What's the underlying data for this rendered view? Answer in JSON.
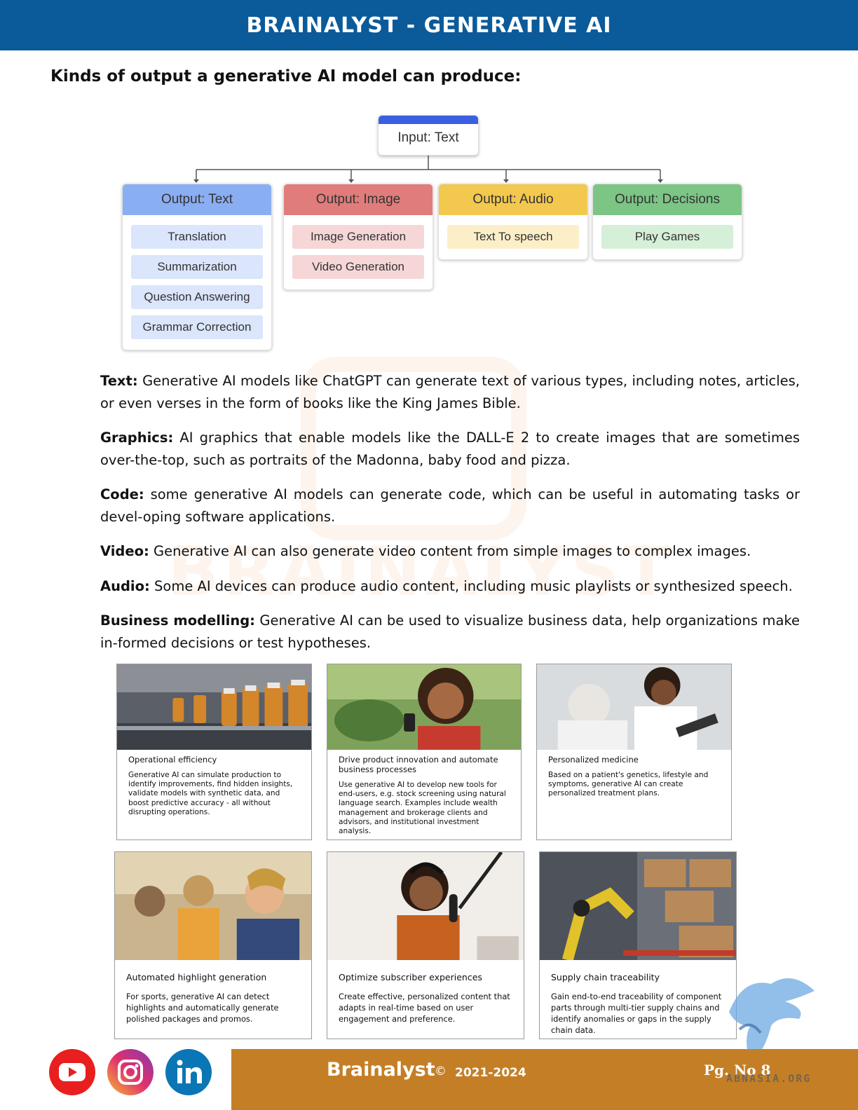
{
  "header": {
    "title": "BRAINALYST - GENERATIVE AI"
  },
  "section_heading": "Kinds of output a generative AI model can produce:",
  "watermark": {
    "text": "BRAINALYST"
  },
  "diagram": {
    "input": "Input: Text",
    "columns": [
      {
        "head": "Output: Text",
        "color": "#8aaef2",
        "items": [
          "Translation",
          "Summarization",
          "Question Answering",
          "Grammar Correction"
        ]
      },
      {
        "head": "Output: Image",
        "color": "#e17c7c",
        "items": [
          "Image Generation",
          "Video Generation"
        ]
      },
      {
        "head": "Output: Audio",
        "color": "#f3c84f",
        "items": [
          "Text To speech"
        ]
      },
      {
        "head": "Output: Decisions",
        "color": "#7cc585",
        "items": [
          "Play Games"
        ]
      }
    ]
  },
  "paragraphs": [
    {
      "label": "Text:",
      "text": " Generative AI models like ChatGPT can generate text of various types, including notes, articles, or even verses in the form of books like the King James Bible."
    },
    {
      "label": "Graphics:",
      "text": " AI graphics that enable models like the DALL-E 2 to create images that are sometimes over-the-top, such as portraits of the Madonna, baby food and pizza."
    },
    {
      "label": "Code:",
      "text": " some generative AI models can generate code, which can be useful in automating tasks or devel-oping software applications."
    },
    {
      "label": "Video:",
      "text": " Generative AI can also generate video content from simple images to complex images."
    },
    {
      "label": "Audio:",
      "text": " Some AI devices can produce audio content, including music playlists or synthesized speech."
    },
    {
      "label": "Business modelling:",
      "text": " Generative AI can be used to visualize business data, help organizations make in-formed decisions or test hypotheses."
    }
  ],
  "cards": [
    {
      "title": "Operational efficiency",
      "body": "Generative AI can simulate production to identify improvements, find hidden insights, validate models with synthetic data, and boost predictive accuracy - all without disrupting operations."
    },
    {
      "title": "Drive product innovation and automate business processes",
      "body": "Use generative AI to develop new tools for end-users, e.g. stock screening using natural language search. Examples include wealth management and brokerage clients and advisors, and institutional investment analysis."
    },
    {
      "title": "Personalized medicine",
      "body": "Based on a patient's genetics, lifestyle and symptoms, generative AI can create personalized treatment plans."
    },
    {
      "title": "Automated highlight generation",
      "body": "For sports, generative AI can detect highlights and automatically generate polished packages and promos."
    },
    {
      "title": "Optimize subscriber experiences",
      "body": "Create effective, personalized content that adapts in real-time based on user engagement and preference."
    },
    {
      "title": "Supply chain traceability",
      "body": "Gain end-to-end traceability of component parts through multi-tier supply chains and identify anomalies or gaps in the supply chain data."
    }
  ],
  "footer": {
    "brand": "Brainalyst",
    "copyright": "©",
    "years": "2021-2024",
    "page": "Pg. No 8",
    "site": "ABNASIA.ORG"
  },
  "colors": {
    "header_blue": "#0b5a9a",
    "footer_orange": "#c47f26"
  }
}
